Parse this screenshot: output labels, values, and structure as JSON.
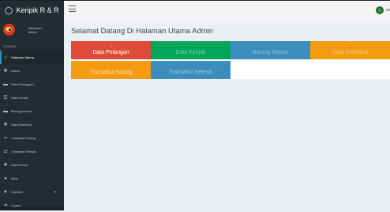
{
  "app": {
    "title": "Keripik R & R"
  },
  "user": {
    "greeting": "Welcome,",
    "name": "admin",
    "mini": "ad"
  },
  "sidebar": {
    "section": "GENERAL",
    "items": [
      {
        "label": "Halaman Utama",
        "icon": "home-icon"
      },
      {
        "label": "Admin",
        "icon": "plus-icon"
      },
      {
        "label": "Data Pelanggan",
        "icon": "cart-icon"
      },
      {
        "label": "Data Keripik",
        "icon": "list-icon"
      },
      {
        "label": "Barang masuk",
        "icon": "cart-icon"
      },
      {
        "label": "Data Distribusi",
        "icon": "plus-icon"
      },
      {
        "label": "Transaksi Hutang",
        "icon": "minus-icon"
      },
      {
        "label": "Transaksi Selesai",
        "icon": "exchange-icon"
      },
      {
        "label": "Data Retum",
        "icon": "plus-icon"
      },
      {
        "label": "Akun",
        "icon": "user-icon"
      },
      {
        "label": "Laporan",
        "icon": "star-icon"
      },
      {
        "label": "Logout",
        "icon": "sign-out-icon"
      }
    ]
  },
  "main": {
    "title": "Selamat Datang Di Halaman Utama Admin",
    "tiles": [
      {
        "label": "Data Pelangan"
      },
      {
        "label": "Data Keripik"
      },
      {
        "label": "Barang Masuk"
      },
      {
        "label": "Data Distribusi"
      },
      {
        "label": "Transaksi Hutang"
      },
      {
        "label": "Transaksi Selesai"
      }
    ]
  },
  "colors": {
    "red": "#dd4b39",
    "green": "#00a65a",
    "blue": "#3c8dbc",
    "orange": "#f39c12",
    "sidebar": "#222d32"
  }
}
